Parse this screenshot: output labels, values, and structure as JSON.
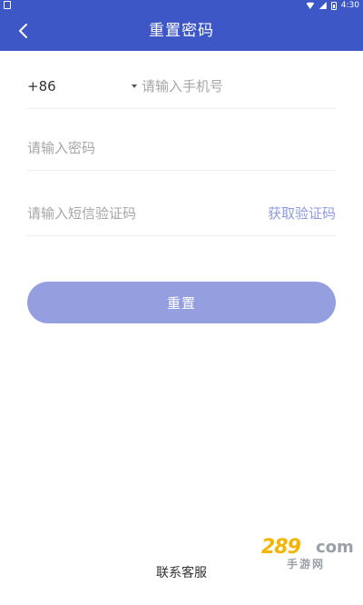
{
  "status_bar": {
    "time": "4:30"
  },
  "app_bar": {
    "title": "重置密码"
  },
  "form": {
    "country_code": "+86",
    "phone_placeholder": "请输入手机号",
    "password_placeholder": "请输入密码",
    "sms_code_placeholder": "请输入短信验证码",
    "get_code_label": "获取验证码"
  },
  "actions": {
    "reset_label": "重置"
  },
  "footer": {
    "contact_label": "联系客服"
  },
  "watermark": {
    "number": "289",
    "domain": "com",
    "text": "手游网"
  },
  "colors": {
    "primary": "#3d57c7",
    "button": "#959fe0",
    "link": "#8d9ae0",
    "placeholder": "#a6a6a6"
  }
}
